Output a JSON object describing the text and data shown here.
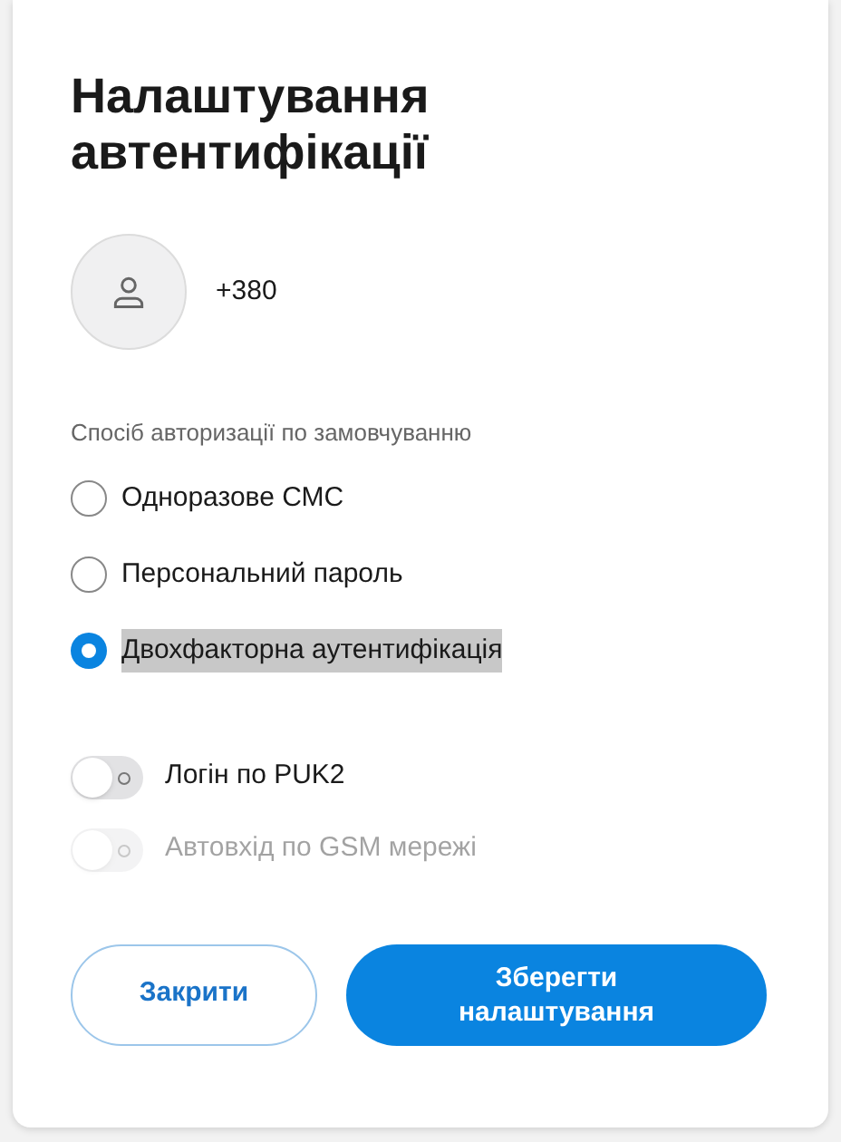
{
  "title": "Налаштування автентифікації",
  "account": {
    "phone": "+380"
  },
  "auth_method": {
    "label": "Спосіб авторизації по замовчуванню",
    "options": [
      {
        "label": "Одноразове СМС",
        "selected": false,
        "highlighted": false
      },
      {
        "label": "Персональний пароль",
        "selected": false,
        "highlighted": false
      },
      {
        "label": "Двохфакторна аутентифікація",
        "selected": true,
        "highlighted": true
      }
    ]
  },
  "toggles": [
    {
      "label": "Логін по PUK2",
      "on": false,
      "disabled": false
    },
    {
      "label": "Автовхід по GSM мережі",
      "on": false,
      "disabled": true
    }
  ],
  "buttons": [
    {
      "label": "Закрити",
      "kind": "secondary"
    },
    {
      "label": "Зберегти налаштування",
      "kind": "primary"
    }
  ]
}
